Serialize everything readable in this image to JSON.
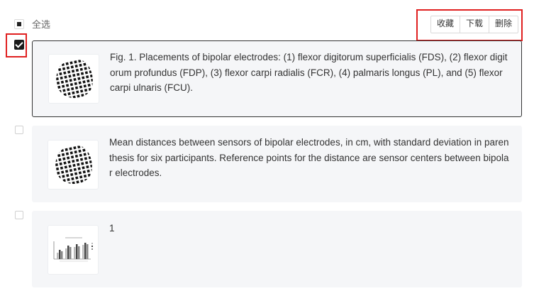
{
  "header": {
    "select_all_label": "全选"
  },
  "toolbar": {
    "favorite_label": "收藏",
    "download_label": "下载",
    "delete_label": "删除"
  },
  "results": [
    {
      "selected": true,
      "thumbnail_icon": "electrode-placement-figure",
      "text": "Fig. 1. Placements of bipolar electrodes: (1) flexor digitorum superficialis (FDS), (2) flexor digitorum profundus (FDP), (3) flexor carpi radialis (FCR), (4) palmaris longus (PL), and (5) flexor carpi ulnaris (FCU)."
    },
    {
      "selected": false,
      "thumbnail_icon": "electrode-placement-figure",
      "text": "Mean distances between sensors of bipolar electrodes, in cm, with standard deviation in parenthesis for six participants. Reference points for the distance are sensor centers between bipolar electrodes."
    },
    {
      "selected": false,
      "thumbnail_icon": "bar-chart-figure",
      "text": "1"
    }
  ]
}
